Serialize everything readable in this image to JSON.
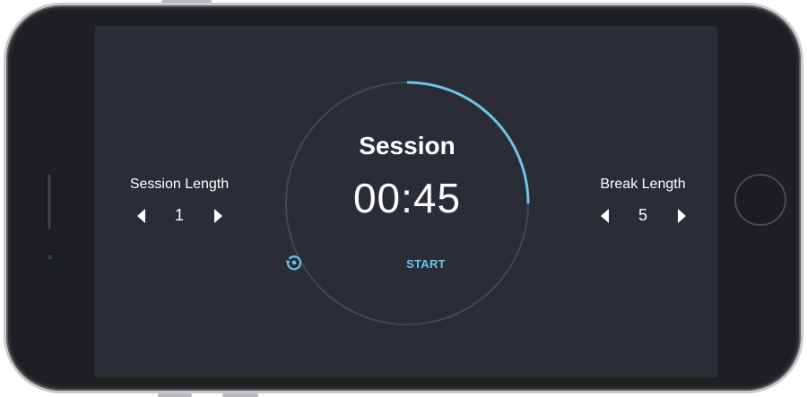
{
  "device": {
    "accent_color": "#6cc3ee",
    "screen_bg": "#2a2d35"
  },
  "session_length": {
    "title": "Session Length",
    "value": "1",
    "decrement_icon": "triangle-left-icon",
    "increment_icon": "triangle-right-icon"
  },
  "break_length": {
    "title": "Break Length",
    "value": "5",
    "decrement_icon": "triangle-left-icon",
    "increment_icon": "triangle-right-icon"
  },
  "timer": {
    "label": "Session",
    "time": "00:45",
    "progress": 0.25,
    "reset_icon": "restart-icon",
    "start_label": "START"
  }
}
